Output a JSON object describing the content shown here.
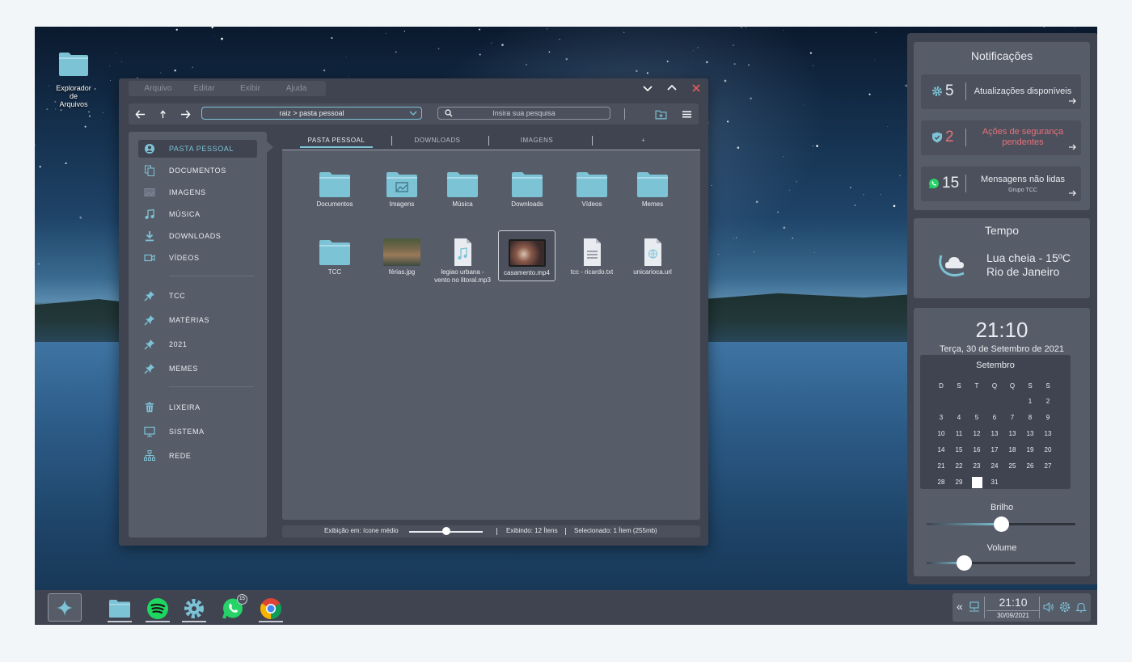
{
  "desktop": {
    "icon_label_line1": "Explorador de",
    "icon_label_line2": "Arquivos"
  },
  "explorer": {
    "menu": [
      "Arquivo",
      "Editar",
      "Exibir",
      "Ajuda"
    ],
    "address": "raiz > pasta pessoal",
    "search_placeholder": "Insira sua pesquisa",
    "sidebar": [
      {
        "label": "PASTA PESSOAL",
        "icon": "user-circle-icon"
      },
      {
        "label": "DOCUMENTOS",
        "icon": "documents-icon"
      },
      {
        "label": "IMAGENS",
        "icon": "image-icon"
      },
      {
        "label": "MÚSICA",
        "icon": "music-note-icon"
      },
      {
        "label": "DOWNLOADS",
        "icon": "download-icon"
      },
      {
        "label": "VÍDEOS",
        "icon": "video-camera-icon"
      },
      {
        "label": "TCC",
        "icon": "pin-icon"
      },
      {
        "label": "MATÉRIAS",
        "icon": "pin-icon"
      },
      {
        "label": "2021",
        "icon": "pin-icon"
      },
      {
        "label": "MEMES",
        "icon": "pin-icon"
      },
      {
        "label": "LIXEIRA",
        "icon": "trash-icon"
      },
      {
        "label": "SISTEMA",
        "icon": "monitor-icon"
      },
      {
        "label": "REDE",
        "icon": "network-icon"
      }
    ],
    "tabs": [
      "PASTA PESSOAL",
      "DOWNLOADS",
      "IMAGENS",
      "+"
    ],
    "files": [
      {
        "name": "Documentos",
        "type": "folder"
      },
      {
        "name": "Imagens",
        "type": "folder-image"
      },
      {
        "name": "Música",
        "type": "folder"
      },
      {
        "name": "Downloads",
        "type": "folder"
      },
      {
        "name": "Vídeos",
        "type": "folder"
      },
      {
        "name": "Memes",
        "type": "folder"
      },
      {
        "name": "TCC",
        "type": "folder"
      },
      {
        "name": "férias.jpg",
        "type": "photo"
      },
      {
        "name_line1": "legiao urbana -",
        "name_line2": "vento no litoral.mp3",
        "type": "audio"
      },
      {
        "name": "casamento.mp4",
        "type": "video",
        "selected": true
      },
      {
        "name": "tcc - ricardo.txt",
        "type": "text"
      },
      {
        "name": "unicarioca.url",
        "type": "url"
      }
    ],
    "status": {
      "view": "Exibição em: ícone médio",
      "showing": "Exibindo: 12 Ítens",
      "selected": "Selecionado: 1 Ítem (255mb)",
      "icon_size_level": 0.5
    }
  },
  "panel": {
    "notifications_title": "Notificações",
    "notifications": [
      {
        "count": "5",
        "text": "Atualizações disponíveis",
        "icon": "gear-icon"
      },
      {
        "count": "2",
        "text_line1": "Ações de segurança",
        "text_line2": "pendentes",
        "icon": "shield-icon"
      },
      {
        "count": "15",
        "text": "Mensagens não lidas",
        "sub": "Grupo TCC",
        "icon": "whatsapp-icon"
      }
    ],
    "weather_title": "Tempo",
    "weather_line1": "Lua cheia - 15ºC",
    "weather_line2": "Rio de Janeiro",
    "clock": "21:10",
    "date": "Terça, 30 de Setembro de 2021",
    "calendar_month": "Setembro",
    "calendar_headers": [
      "D",
      "S",
      "T",
      "Q",
      "Q",
      "S",
      "S"
    ],
    "calendar_rows": [
      [
        "",
        "",
        "",
        "",
        "",
        "1",
        "2"
      ],
      [
        "3",
        "4",
        "5",
        "6",
        "7",
        "8",
        "9"
      ],
      [
        "10",
        "11",
        "12",
        "13",
        "13",
        "13",
        "13"
      ],
      [
        "14",
        "15",
        "16",
        "17",
        "18",
        "19",
        "20"
      ],
      [
        "21",
        "22",
        "23",
        "24",
        "25",
        "26",
        "27"
      ],
      [
        "28",
        "29",
        "30",
        "31",
        "",
        "",
        ""
      ]
    ],
    "today": "30",
    "brightness_label": "Brilho",
    "brightness_level": 0.5,
    "volume_label": "Volume",
    "volume_level": 0.25
  },
  "taskbar": {
    "whatsapp_badge": "15",
    "tray_time": "21:10",
    "tray_date": "30/09/2021",
    "tray_collapse": "«"
  },
  "colors": {
    "accent": "#7cc3d6",
    "alert": "#e8717a",
    "window": "#3f4450",
    "panel": "#575c69"
  }
}
